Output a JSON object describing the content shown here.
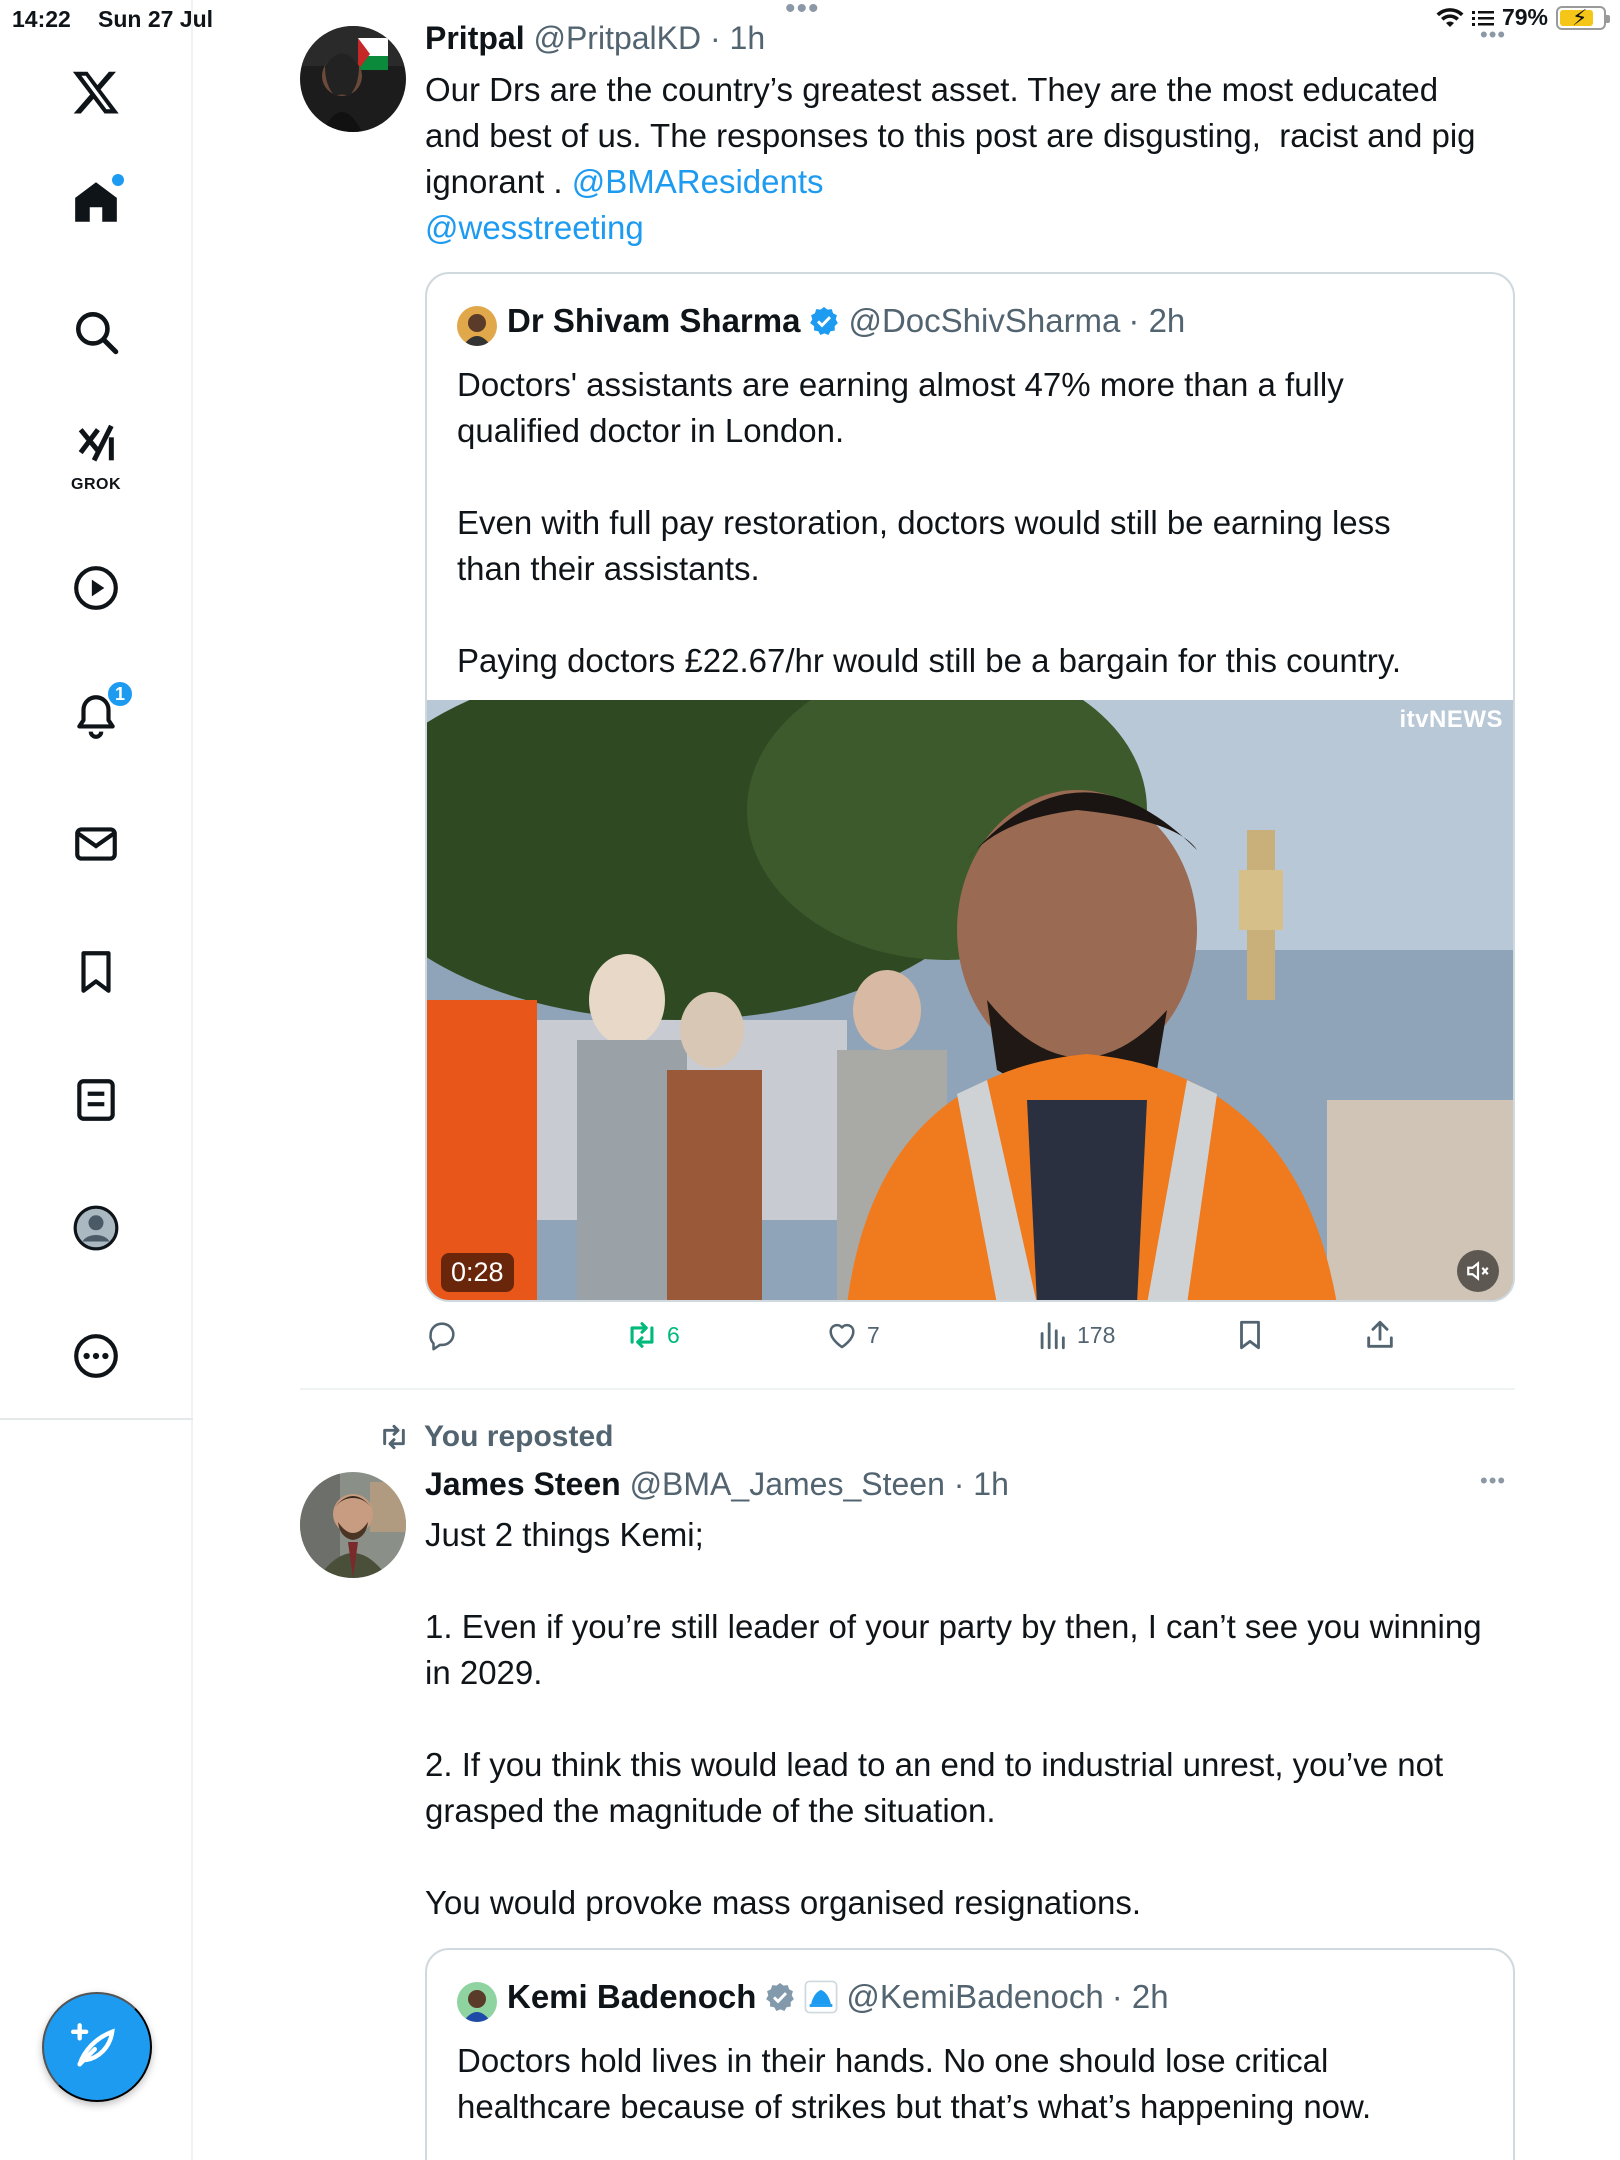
{
  "status_bar": {
    "time": "14:22",
    "date": "Sun 27 Jul",
    "battery": "79%",
    "battery_level": 0.79
  },
  "sidebar": {
    "items": [
      {
        "icon": "x-logo-icon"
      },
      {
        "icon": "home-icon",
        "has_dot": true
      },
      {
        "icon": "search-icon"
      },
      {
        "icon": "grok-icon",
        "label": "GROK"
      },
      {
        "icon": "video-icon"
      },
      {
        "icon": "notifications-icon",
        "badge": "1"
      },
      {
        "icon": "messages-icon"
      },
      {
        "icon": "bookmarks-icon"
      },
      {
        "icon": "lists-icon"
      },
      {
        "icon": "profile-icon"
      },
      {
        "icon": "more-icon"
      }
    ],
    "compose_icon": "compose-icon"
  },
  "tweets": [
    {
      "author": "Pritpal",
      "handle": "@PritpalKD",
      "time": "· 1h",
      "text_before": "Our Drs are the country’s greatest asset. They are the most educated\nand best of us. The responses to this post are disgusting,  racist and pig\nignorant . ",
      "mention_1": "@BMAResidents",
      "mention_2": "@wesstreeting",
      "quote": {
        "author": "Dr Shivam Sharma",
        "handle": "@DocShivSharma",
        "time": "· 2h",
        "text": "Doctors' assistants are earning almost 47% more than a fully\nqualified doctor in London.\n\nEven with full pay restoration, doctors would still be earning less\nthan their assistants.\n\nPaying doctors £22.67/hr would still be a bargain for this country.",
        "video_duration": "0:28",
        "video_watermark": "itvNEWS"
      },
      "actions": {
        "replies": "",
        "reposts": "6",
        "likes": "7",
        "views": "178"
      }
    },
    {
      "repost_label": "You reposted",
      "author": "James Steen",
      "handle": "@BMA_James_Steen",
      "time": "· 1h",
      "text": "Just 2 things Kemi;\n\n1. Even if you’re still leader of your party by then, I can’t see you winning\nin 2029.\n\n2. If you think this would lead to an end to industrial unrest, you’ve not\ngrasped the magnitude of the situation.\n\nYou would provoke mass organised resignations.",
      "quote": {
        "author": "Kemi Badenoch",
        "handle": "@KemiBadenoch",
        "time": "· 2h",
        "text": "Doctors hold lives in their hands. No one should lose critical\nhealthcare because of strikes but that’s what’s happening now."
      }
    }
  ],
  "colors": {
    "accent": "#1d9bf0",
    "retweet_green": "#00ba7c",
    "secondary_text": "#536471",
    "border": "#cfd9de"
  }
}
